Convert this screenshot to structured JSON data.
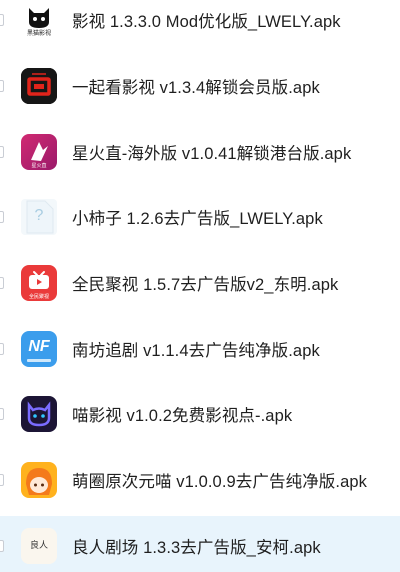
{
  "files": [
    {
      "name": "影视 1.3.3.0 Mod优化版_LWELY.apk",
      "icon": "black-cat-app-icon",
      "icon_text": "黑猫影视"
    },
    {
      "name": "一起看影视 v1.3.4解锁会员版.apk",
      "icon": "red-square-logo-icon"
    },
    {
      "name": "星火直-海外版 v1.0.41解锁港台版.apk",
      "icon": "xinghuo-app-icon",
      "icon_text": "星火直"
    },
    {
      "name": "小柿子 1.2.6去广告版_LWELY.apk",
      "icon": "unknown-file-icon",
      "icon_text": "?"
    },
    {
      "name": "全民聚视 1.5.7去广告版v2_东明.apk",
      "icon": "tv-app-icon",
      "icon_text": "全民聚视"
    },
    {
      "name": "南坊追剧 v1.1.4去广告纯净版.apk",
      "icon": "nf-app-icon",
      "icon_text": "NF"
    },
    {
      "name": "喵影视 v1.0.2免费影视点-.apk",
      "icon": "cat-face-app-icon"
    },
    {
      "name": "萌圈原次元喵 v1.0.0.9去广告纯净版.apk",
      "icon": "anime-girl-app-icon"
    },
    {
      "name": "良人剧场 1.3.3去广告版_安柯.apk",
      "icon": "liangren-app-icon",
      "icon_text": "良人"
    }
  ],
  "colors": {
    "selected_row_bg": "#e8f4fc",
    "text": "#1f1f1f"
  }
}
